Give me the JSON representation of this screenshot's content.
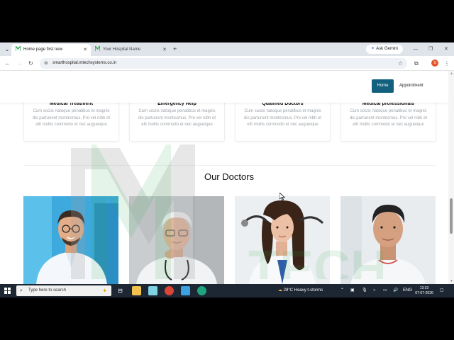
{
  "browser": {
    "tabs": [
      {
        "title": "Home page first new",
        "active": true
      },
      {
        "title": "Your Hospital Name",
        "active": false
      }
    ],
    "new_tab": "+",
    "gemini_label": "Ask Gemini",
    "url": "smarthospital.mtechsystems.co.in",
    "profile_initial": "S"
  },
  "site_nav": {
    "home": "Home",
    "appointment": "Appointment"
  },
  "services": [
    {
      "title": "Medical Treatment",
      "text": "Cum sociis natoque penatibus et magnis dis parturient montesmus. Pro vel nibh et elit mollis commodo et nec augueique"
    },
    {
      "title": "Emergency Help",
      "text": "Cum sociis natoque penatibus et magnis dis parturient montesmus. Pro vel nibh et elit mollis commodo et nec augueique"
    },
    {
      "title": "Qualified Doctors",
      "text": "Cum sociis natoque penatibus et magnis dis parturient montesmus. Pro vel nibh et elit mollis commodo et nec augueique"
    },
    {
      "title": "Medical professionals",
      "text": "Cum sociis natoque penatibus et magnis dis parturient montesmus. Pro vel nibh et elit mollis commodo et nec augueique"
    }
  ],
  "doctors_section": {
    "title": "Our Doctors"
  },
  "watermark_text": "TECH",
  "taskbar": {
    "search_placeholder": "Type here to search",
    "weather_temp": "28°C",
    "weather_text": "Heavy t-storms",
    "language": "ENG",
    "time": "13:33",
    "date": "07-07-2026"
  },
  "colors": {
    "brand_button": "#12607e",
    "taskbar": "#1d2733",
    "watermark_green": "#2fa84f"
  }
}
